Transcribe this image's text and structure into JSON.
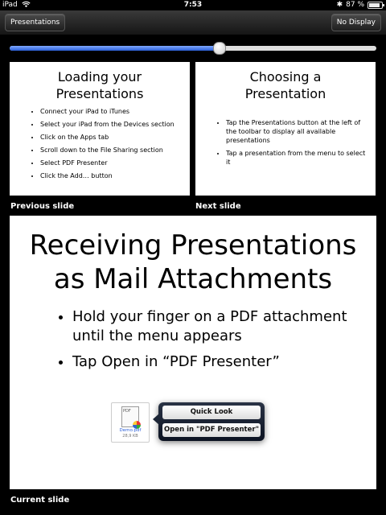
{
  "status_bar": {
    "device": "iPad",
    "time": "7:53",
    "battery": "87 %"
  },
  "toolbar": {
    "presentations_label": "Presentations",
    "display_label": "No Display"
  },
  "slider": {
    "progress": 0.57
  },
  "previous_slide": {
    "caption": "Previous slide",
    "title_line1": "Loading your",
    "title_line2": "Presentations",
    "bullets": [
      "Connect your iPad to iTunes",
      "Select your iPad from the Devices section",
      "Click on the Apps tab",
      "Scroll down to the File Sharing section",
      "Select PDF Presenter",
      "Click the Add… button"
    ]
  },
  "next_slide": {
    "caption": "Next slide",
    "title_line1": "Choosing a",
    "title_line2": "Presentation",
    "bullets": [
      "Tap the Presentations button at the left of the toolbar to display all available presentations",
      "Tap a presentation from the menu to select it"
    ]
  },
  "current_slide": {
    "caption": "Current slide",
    "title_line1": "Receiving Presentations",
    "title_line2": "as Mail Attachments",
    "bullets": [
      "Hold your finger on a PDF attachment until the menu appears",
      "Tap Open in “PDF Presenter”"
    ],
    "attachment": {
      "icon_text": "PDF",
      "filename": "Demo.pdf",
      "size": "28,9 KB"
    },
    "menu": {
      "quick_look": "Quick Look",
      "open_in": "Open in \"PDF Presenter\""
    }
  }
}
